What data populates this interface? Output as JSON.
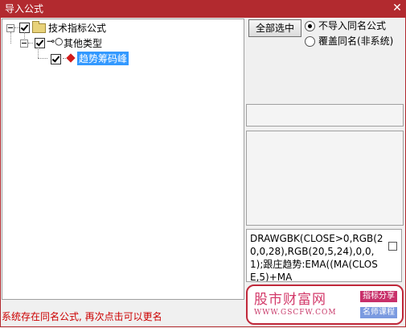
{
  "window": {
    "title": "导入公式",
    "close_glyph": "✕"
  },
  "tree": {
    "root": {
      "label": "技术指标公式",
      "checked": true,
      "icon": "folder-icon"
    },
    "child": {
      "label": "其他类型",
      "checked": true,
      "icon": "key-icon",
      "key_glyph": "⊸○"
    },
    "leaf": {
      "label": "趋势筹码峰",
      "checked": true,
      "icon": "formula-gem-icon",
      "selected": true
    }
  },
  "right_panel": {
    "select_all_label": "全部选中",
    "options": [
      {
        "label": "不导入同名公式",
        "selected": true
      },
      {
        "label": "覆盖同名(非系统)",
        "selected": false
      }
    ],
    "code_preview": "DRAWGBK(CLOSE>0,RGB(20,0,28),RGB(20,5,24),0,0,1);跟庄趋势:EMA((MA(CLOSE,5)+MA"
  },
  "status_text": "系统存在同名公式, 再次点击可以更名",
  "watermark": {
    "brand": "股市财富网",
    "url": "WWW.GSCFW.COM",
    "tag1": "指标分享",
    "tag2": "名师课程"
  }
}
